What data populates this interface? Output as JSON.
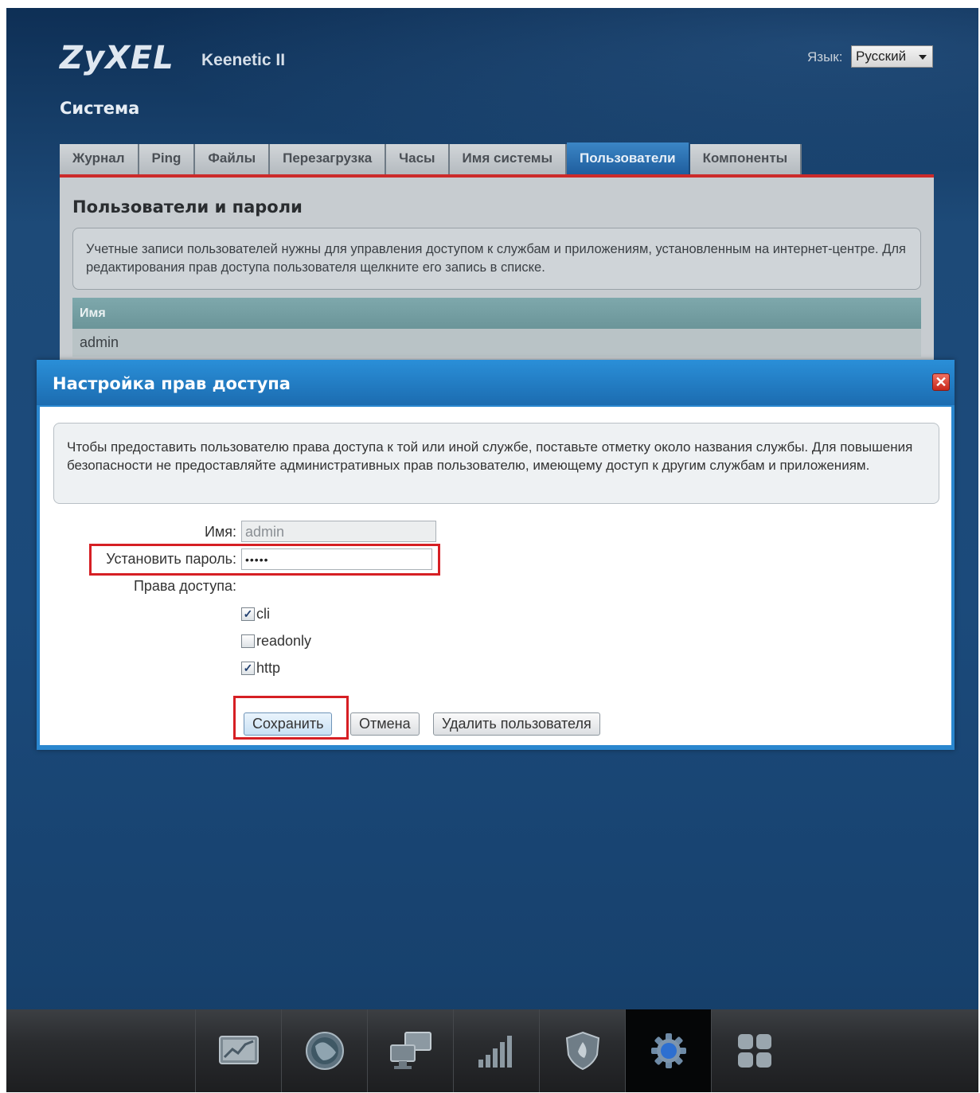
{
  "header": {
    "logo": "ZyXEL",
    "model": "Keenetic II",
    "language_label": "Язык:",
    "language_value": "Русский"
  },
  "section_title": "Система",
  "tabs": [
    {
      "label": "Журнал"
    },
    {
      "label": "Ping"
    },
    {
      "label": "Файлы"
    },
    {
      "label": "Перезагрузка"
    },
    {
      "label": "Часы"
    },
    {
      "label": "Имя системы"
    },
    {
      "label": "Пользователи",
      "active": true
    },
    {
      "label": "Компоненты"
    }
  ],
  "panel": {
    "title": "Пользователи и пароли",
    "info": "Учетные записи пользователей нужны для управления доступом к службам и приложениям, установленным на интернет-центре. Для редактирования прав доступа пользователя щелкните его запись в списке.",
    "table_header": "Имя",
    "rows": [
      "admin"
    ]
  },
  "dialog": {
    "title": "Настройка прав доступа",
    "close": "✕",
    "info": "Чтобы предоставить пользователю права доступа к той или иной службе, поставьте отметку около названия службы. Для повышения безопасности не предоставляйте административных прав пользователю, имеющему доступ к другим службам и приложениям.",
    "name_label": "Имя:",
    "name_value": "admin",
    "password_label": "Установить пароль:",
    "password_value": "•••••",
    "rights_label": "Права доступа:",
    "rights": [
      {
        "label": "cli",
        "checked": true
      },
      {
        "label": "readonly",
        "checked": false
      },
      {
        "label": "http",
        "checked": true
      }
    ],
    "buttons": {
      "save": "Сохранить",
      "cancel": "Отмена",
      "delete": "Удалить пользователя"
    }
  },
  "footer_nav": [
    {
      "icon": "chart-monitor-icon"
    },
    {
      "icon": "globe-icon"
    },
    {
      "icon": "network-computers-icon"
    },
    {
      "icon": "signal-bars-icon"
    },
    {
      "icon": "shield-icon"
    },
    {
      "icon": "gear-icon",
      "active": true
    },
    {
      "icon": "apps-grid-icon"
    }
  ],
  "colors": {
    "accent_red": "#d61f24",
    "dialog_blue": "#2a87cf",
    "background_blue": "#1b4a7b"
  }
}
